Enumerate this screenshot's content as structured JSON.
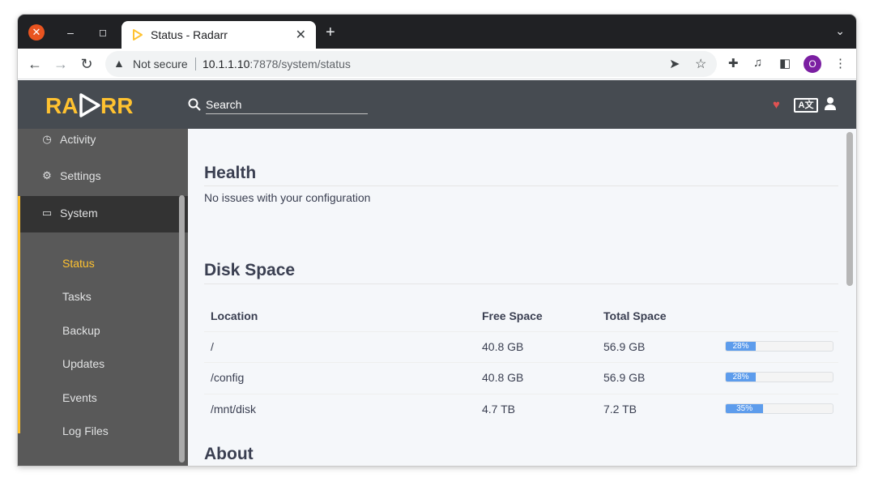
{
  "browser": {
    "tab_title": "Status - Radarr",
    "address": {
      "security_label": "Not secure",
      "host": "10.1.1.10",
      "path": ":7878/system/status"
    },
    "profile_initial": "O"
  },
  "header": {
    "logo_text": "RADARR",
    "search_placeholder": "Search"
  },
  "sidebar": {
    "items": [
      {
        "label": "Activity",
        "icon": "clock-icon"
      },
      {
        "label": "Settings",
        "icon": "gears-icon"
      },
      {
        "label": "System",
        "icon": "laptop-icon"
      }
    ],
    "system_children": [
      "Status",
      "Tasks",
      "Backup",
      "Updates",
      "Events",
      "Log Files"
    ],
    "active_child": "Status"
  },
  "main": {
    "health": {
      "title": "Health",
      "message": "No issues with your configuration"
    },
    "disk_space": {
      "title": "Disk Space",
      "headers": {
        "location": "Location",
        "free": "Free Space",
        "total": "Total Space"
      },
      "rows": [
        {
          "location": "/",
          "free": "40.8 GB",
          "total": "56.9 GB",
          "percent_label": "28%",
          "percent": 28
        },
        {
          "location": "/config",
          "free": "40.8 GB",
          "total": "56.9 GB",
          "percent_label": "28%",
          "percent": 28
        },
        {
          "location": "/mnt/disk",
          "free": "4.7 TB",
          "total": "7.2 TB",
          "percent_label": "35%",
          "percent": 35
        }
      ]
    },
    "about": {
      "title": "About"
    }
  },
  "colors": {
    "accent": "#ffc230",
    "header_bg": "#464b51",
    "sidebar_bg": "#595959",
    "progress": "#5d9cec"
  }
}
